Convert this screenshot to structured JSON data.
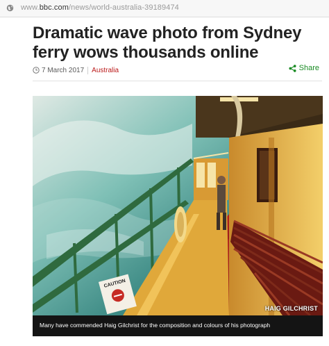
{
  "browser": {
    "url_prefix": "www.",
    "url_domain": "bbc.com",
    "url_path": "/news/world-australia-39189474"
  },
  "article": {
    "headline": "Dramatic wave photo from Sydney ferry wows thousands online",
    "date": "7 March 2017",
    "category": "Australia",
    "share_label": "Share",
    "image_credit": "HAIG GILCHRIST",
    "caption": "Many have commended Haig Gilchrist for the composition and colours of his photograph",
    "image_sign_text": "CAUTION"
  },
  "colors": {
    "category": "#bb1919",
    "share": "#1a8b24",
    "caption_bg": "#141414",
    "ferry_yellow": "#e9b949",
    "deck_red": "#8c1414",
    "wave_teal": "#3f9a92"
  }
}
